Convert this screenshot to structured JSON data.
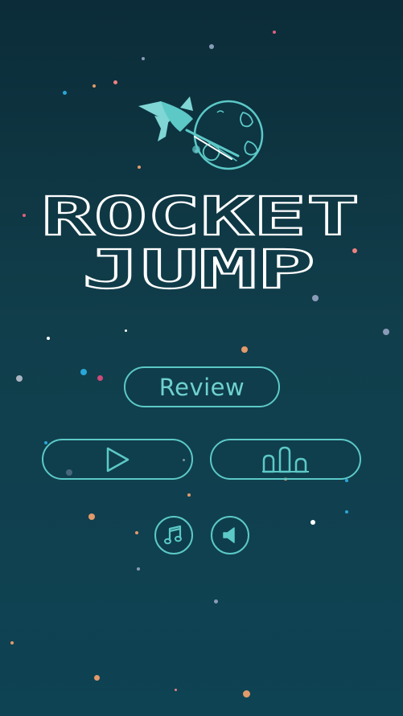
{
  "title": {
    "line1": "ROCKET",
    "line2": "JUMP"
  },
  "menu": {
    "review_label": "Review"
  },
  "icons": {
    "play": "play-icon",
    "leaderboard": "leaderboard-icon",
    "music": "music-note-icon",
    "sound": "speaker-icon",
    "logo": "rocket-planet-icon"
  },
  "colors": {
    "accent": "#5cc9c7",
    "title_stroke": "#ffffff",
    "background_top": "#0b2c38",
    "background_bottom": "#0e4354"
  }
}
